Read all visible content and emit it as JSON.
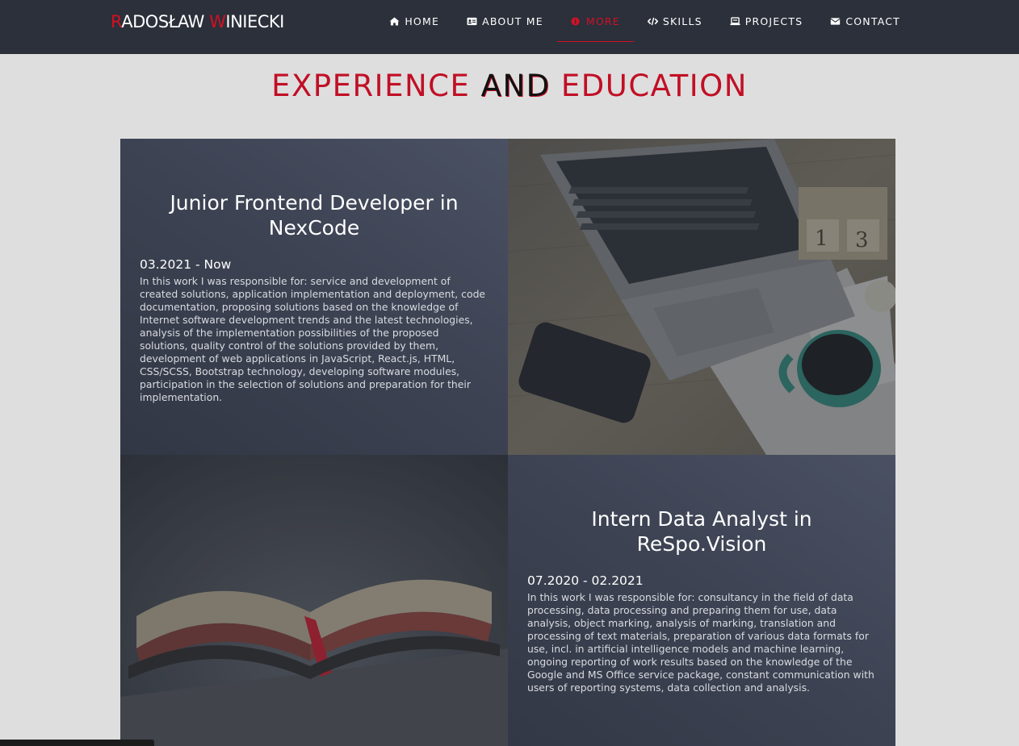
{
  "brand": {
    "first_initial": "R",
    "first_rest": "ADOSŁAW ",
    "last_initial": "W",
    "last_rest": "INIECKI"
  },
  "nav": {
    "items": [
      {
        "label": "HOME",
        "icon": "home-icon"
      },
      {
        "label": "ABOUT ME",
        "icon": "id-card-icon"
      },
      {
        "label": "MORE",
        "icon": "info-icon",
        "active": true
      },
      {
        "label": "SKILLS",
        "icon": "code-icon"
      },
      {
        "label": "PROJECTS",
        "icon": "laptop-icon"
      },
      {
        "label": "CONTACT",
        "icon": "envelope-icon"
      }
    ]
  },
  "section": {
    "heading_part1": "EXPERIENCE",
    "heading_part2": " AND ",
    "heading_part3": "EDUCATION"
  },
  "experience": [
    {
      "title": "Junior Frontend Developer in NexCode",
      "dates": "03.2021 - Now",
      "description": "In this work I was responsible for: service and development of created solutions, application implementation and deployment, code documentation, proposing solutions based on the knowledge of Internet software development trends and the latest technologies, analysis of the implementation possibilities of the proposed solutions, quality control of the solutions provided by them, development of web applications in JavaScript, React.js, HTML, CSS/SCSS, Bootstrap technology, developing software modules, participation in the selection of solutions and preparation for their implementation."
    },
    {
      "title": "Intern Data Analyst in ReSpo.Vision",
      "dates": "07.2020 - 02.2021",
      "description": "In this work I was responsible for: consultancy in the field of data processing, data processing and preparing them for use, data analysis, object marking, analysis of marking, translation and processing of text materials, preparation of various data formats for use, incl. in artificial intelligence models and machine learning, ongoing reporting of work results based on the knowledge of the Google and MS Office service package, constant communication with users of reporting systems, data collection and analysis."
    }
  ],
  "colors": {
    "accent": "#d50f25",
    "navbar_bg": "#2b303a",
    "page_bg": "#dedede",
    "card_bg": "#3d4353"
  }
}
